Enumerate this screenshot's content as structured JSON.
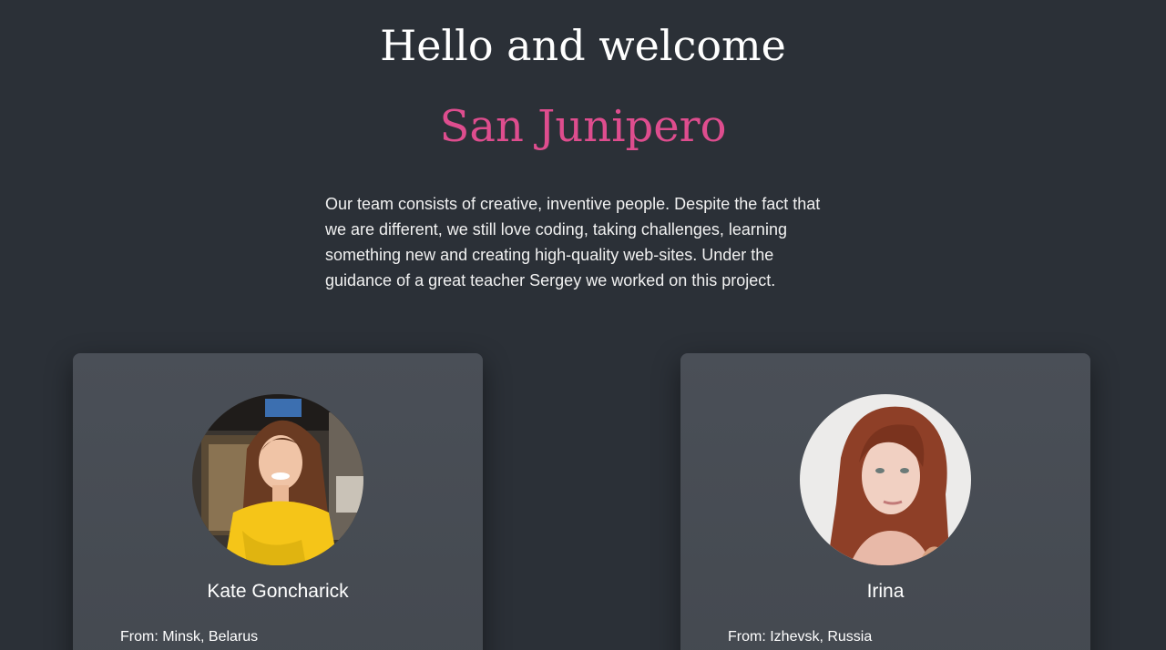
{
  "hero": {
    "title": "Hello and welcome",
    "brand": "San Junipero",
    "brand_color": "#de4d8e"
  },
  "intro": {
    "text": "Our team consists of creative, inventive people. Despite the fact that we are different, we still love coding, taking challenges, learning something new and creating high-quality web-sites. Under the guidance of a great teacher Sergey we worked on this project."
  },
  "team": [
    {
      "name": "Kate Goncharick",
      "from_label": "From:",
      "from": "Minsk, Belarus",
      "from_text": "From: Minsk, Belarus",
      "photo": "portrait-photo"
    },
    {
      "name": "Irina",
      "from_label": "From:",
      "from": "Izhevsk, Russia",
      "from_text": "From: Izhevsk, Russia",
      "photo": "portrait-photo"
    }
  ]
}
